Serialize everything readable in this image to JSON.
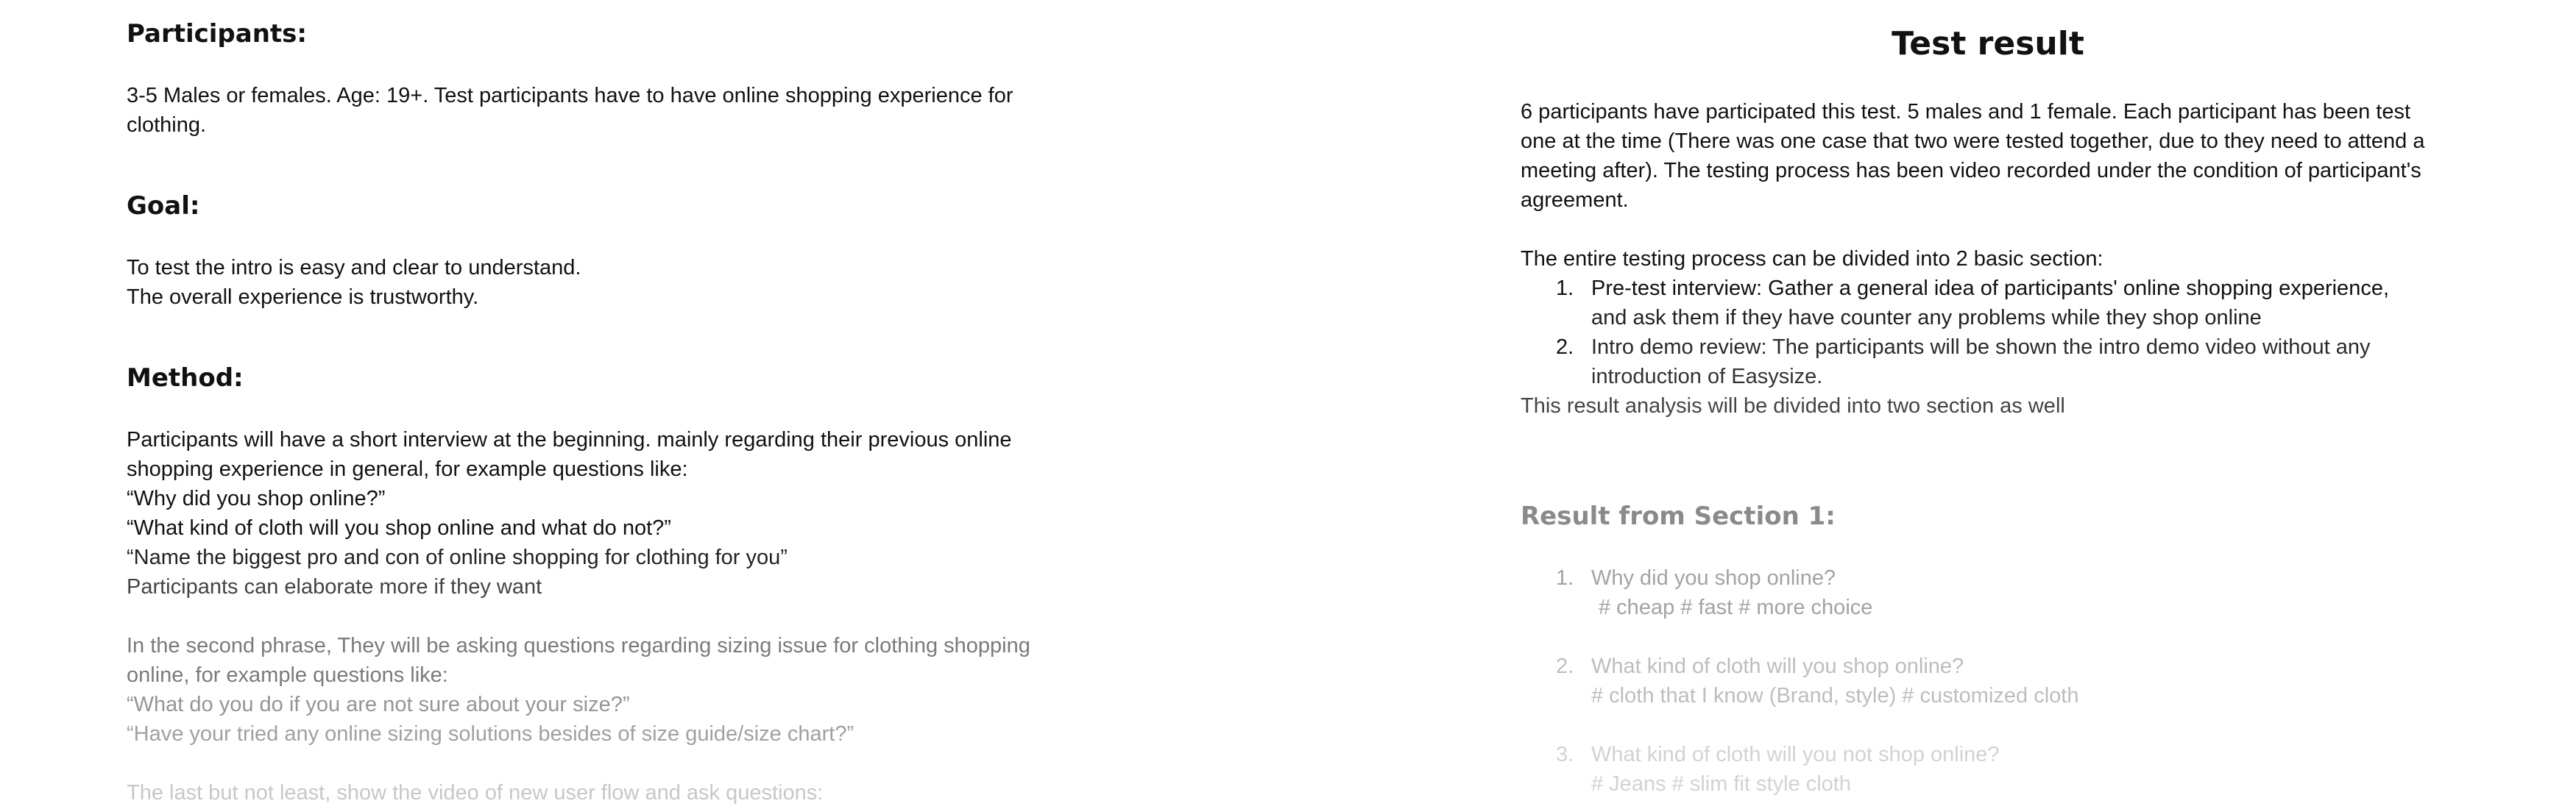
{
  "left": {
    "participants_heading": "Participants:",
    "participants_text": [
      "3-5 Males or females. Age: 19+.  Test participants have to have online shopping experience for",
      "clothing."
    ],
    "goal_heading": "Goal:",
    "goal_text": [
      "To test the intro is easy and clear to understand.",
      "The overall experience is trustworthy."
    ],
    "method_heading": "Method:",
    "method_text": [
      "Participants will have a short interview at the beginning. mainly regarding their previous online",
      "shopping experience in general, for example questions like:",
      "“Why did you shop online?”",
      "“What kind of cloth will you shop online and what do not?”",
      "“Name the biggest pro and con of online shopping for clothing for you”",
      "Participants can elaborate more if they want"
    ],
    "method_text_2": [
      "In the second phrase, They will be asking questions regarding sizing issue for clothing shopping",
      "online, for example questions like:",
      "“What do you do if you are not sure about your size?”",
      "“Have your tried any online sizing solutions besides of size guide/size chart?”"
    ],
    "method_text_3": "The last but not least, show the video of new user flow and ask questions:"
  },
  "right": {
    "title": "Test result",
    "intro_text": [
      "6 participants have participated this test. 5 males and 1 female. Each participant has been test",
      "one at the time (There was one case that two were tested together, due to they need to attend a",
      "meeting after). The testing process has been video recorded under the condition of participant's",
      "agreement."
    ],
    "sections_intro": "The entire testing process can be divided into 2 basic section:",
    "sections": [
      {
        "num": "1.",
        "lines": [
          "Pre-test interview: Gather a general idea of participants' online shopping experience,",
          "and ask them if they have counter any problems while they shop online"
        ]
      },
      {
        "num": "2.",
        "lines": [
          "Intro demo review: The participants will be shown the intro demo video without any",
          "introduction of Easysize."
        ]
      }
    ],
    "analysis_text": "This result analysis will be divided into two section as well",
    "result_heading": "Result from Section 1:",
    "results": [
      {
        "num": "1.",
        "question": "Why did you shop online?",
        "tags": "# cheap   # fast   # more choice"
      },
      {
        "num": "2.",
        "question": "What kind of cloth will you shop online?",
        "tags": "# cloth that I know (Brand, style)   # customized cloth"
      },
      {
        "num": "3.",
        "question": "What kind of cloth will you not shop online?",
        "tags": "# Jeans  # slim fit style cloth"
      }
    ]
  },
  "colors": {
    "text": "#111111",
    "fade_1": "#555555",
    "fade_2": "#888888",
    "fade_3": "#b5b5b5",
    "fade_4": "#d0d0d0"
  }
}
